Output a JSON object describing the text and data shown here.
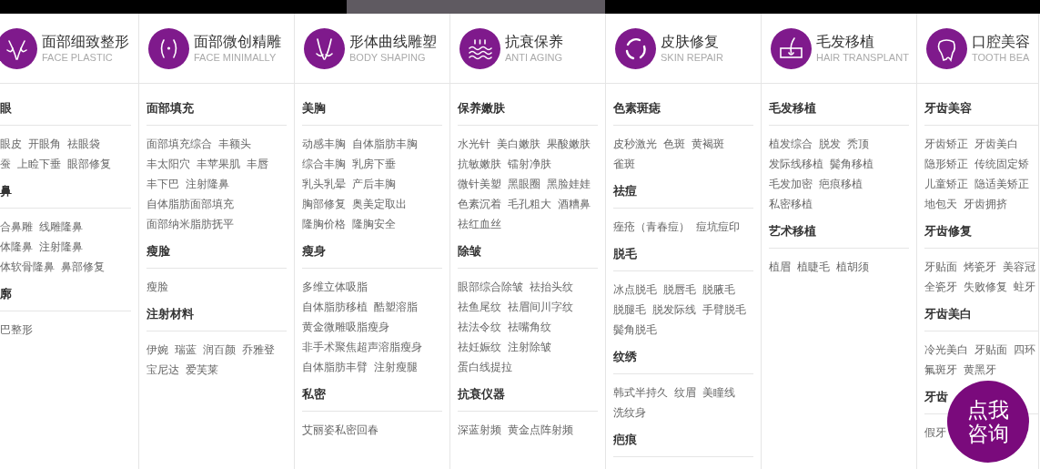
{
  "categories": [
    {
      "title": "面部细致整形",
      "subtitle": "FACE PLASTIC",
      "sections": [
        {
          "heading": "眼",
          "rows": [
            [
              "眼皮",
              "开眼角",
              "祛眼袋"
            ],
            [
              "蚕",
              "上睑下垂",
              "眼部修复"
            ]
          ]
        },
        {
          "heading": "鼻",
          "rows": [
            [
              "合鼻雕",
              "线雕隆鼻"
            ],
            [
              "体隆鼻",
              "注射隆鼻"
            ],
            [
              "体软骨隆鼻",
              "鼻部修复"
            ]
          ]
        },
        {
          "heading": "廓",
          "rows": [
            [
              "巴整形"
            ]
          ]
        }
      ]
    },
    {
      "title": "面部微创精雕",
      "subtitle": "FACE MINIMALLY",
      "sections": [
        {
          "heading": "面部填充",
          "rows": [
            [
              "面部填充综合",
              "丰额头"
            ],
            [
              "丰太阳穴",
              "丰苹果肌",
              "丰唇"
            ],
            [
              "丰下巴",
              "注射隆鼻"
            ],
            [
              "自体脂肪面部填充"
            ],
            [
              "面部纳米脂肪抚平"
            ]
          ]
        },
        {
          "heading": "瘦脸",
          "rows": [
            [
              "瘦脸"
            ]
          ]
        },
        {
          "heading": "注射材料",
          "rows": [
            [
              "伊婉",
              "瑞蓝",
              "润百颜",
              "乔雅登"
            ],
            [
              "宝尼达",
              "爱芙莱"
            ]
          ]
        }
      ]
    },
    {
      "title": "形体曲线雕塑",
      "subtitle": "BODY SHAPING",
      "sections": [
        {
          "heading": "美胸",
          "rows": [
            [
              "动感丰胸",
              "自体脂肪丰胸"
            ],
            [
              "综合丰胸",
              "乳房下垂"
            ],
            [
              "乳头乳晕",
              "产后丰胸"
            ],
            [
              "胸部修复",
              "奥美定取出"
            ],
            [
              "隆胸价格",
              "隆胸安全"
            ]
          ]
        },
        {
          "heading": "瘦身",
          "rows": [
            [
              "多维立体吸脂"
            ],
            [
              "自体脂肪移植",
              "酷塑溶脂"
            ],
            [
              "黄金微雕吸脂瘦身"
            ],
            [
              "非手术聚焦超声溶脂瘦身"
            ],
            [
              "自体脂肪丰臂",
              "注射瘦腿"
            ]
          ]
        },
        {
          "heading": "私密",
          "rows": [
            [
              "艾丽姿私密回春"
            ]
          ]
        }
      ]
    },
    {
      "title": "抗衰保养",
      "subtitle": "ANTI AGING",
      "sections": [
        {
          "heading": "保养嫩肤",
          "rows": [
            [
              "水光针",
              "美白嫩肤",
              "果酸嫩肤"
            ],
            [
              "抗敏嫩肤",
              "镭射净肤"
            ],
            [
              "微针美塑",
              "黑眼圈",
              "黑脸娃娃"
            ],
            [
              "色素沉着",
              "毛孔粗大",
              "酒糟鼻"
            ],
            [
              "祛红血丝"
            ]
          ]
        },
        {
          "heading": "除皱",
          "rows": [
            [
              "眼部综合除皱",
              "祛抬头纹"
            ],
            [
              "祛鱼尾纹",
              "祛眉间川字纹"
            ],
            [
              "祛法令纹",
              "祛嘴角纹"
            ],
            [
              "祛妊娠纹",
              "注射除皱"
            ],
            [
              "蛋白线提拉"
            ]
          ]
        },
        {
          "heading": "抗衰仪器",
          "rows": [
            [
              "深蓝射频",
              "黄金点阵射频"
            ]
          ]
        }
      ]
    },
    {
      "title": "皮肤修复",
      "subtitle": "SKIN REPAIR",
      "sections": [
        {
          "heading": "色素斑痣",
          "rows": [
            [
              "皮秒激光",
              "色斑",
              "黄褐斑"
            ],
            [
              "雀斑"
            ]
          ]
        },
        {
          "heading": "祛痘",
          "rows": [
            [
              "痤疮（青春痘）",
              "痘坑痘印"
            ]
          ]
        },
        {
          "heading": "脱毛",
          "rows": [
            [
              "冰点脱毛",
              "脱唇毛",
              "脱腋毛"
            ],
            [
              "脱腿毛",
              "脱发际线",
              "手臂脱毛"
            ],
            [
              "鬓角脱毛"
            ]
          ]
        },
        {
          "heading": "纹绣",
          "rows": [
            [
              "韩式半持久",
              "纹眉",
              "美瞳线"
            ],
            [
              "洗纹身"
            ]
          ]
        },
        {
          "heading": "疤痕"
        }
      ]
    },
    {
      "title": "毛发移植",
      "subtitle": "HAIR TRANSPLANT",
      "sections": [
        {
          "heading": "毛发移植",
          "rows": [
            [
              "植发综合",
              "脱发",
              "秃顶"
            ],
            [
              "发际线移植",
              "鬓角移植"
            ],
            [
              "毛发加密",
              "疤痕移植"
            ],
            [
              "私密移植"
            ]
          ]
        },
        {
          "heading": "艺术移植",
          "rows": [
            [
              "植眉",
              "植睫毛",
              "植胡须"
            ]
          ]
        }
      ]
    },
    {
      "title": "口腔美容",
      "subtitle": "TOOTH BEA",
      "sections": [
        {
          "heading": "牙齿美容",
          "rows": [
            [
              "牙齿矫正",
              "牙齿美白"
            ],
            [
              "隐形矫正",
              "传统固定矫"
            ],
            [
              "儿童矫正",
              "隐适美矫正"
            ],
            [
              "地包天",
              "牙齿拥挤"
            ]
          ]
        },
        {
          "heading": "牙齿修复",
          "rows": [
            [
              "牙贴面",
              "烤瓷牙",
              "美容冠"
            ],
            [
              "全瓷牙",
              "失败修复",
              "蛀牙"
            ]
          ]
        },
        {
          "heading": "牙齿美白",
          "rows": [
            [
              "冷光美白",
              "牙贴面",
              "四环"
            ],
            [
              "氟斑牙",
              "黄黑牙"
            ]
          ]
        },
        {
          "heading": "牙齿",
          "rows": [
            [
              "假牙"
            ]
          ]
        }
      ]
    }
  ],
  "consult_bubble": {
    "lines": [
      "点我",
      "咨询"
    ]
  }
}
